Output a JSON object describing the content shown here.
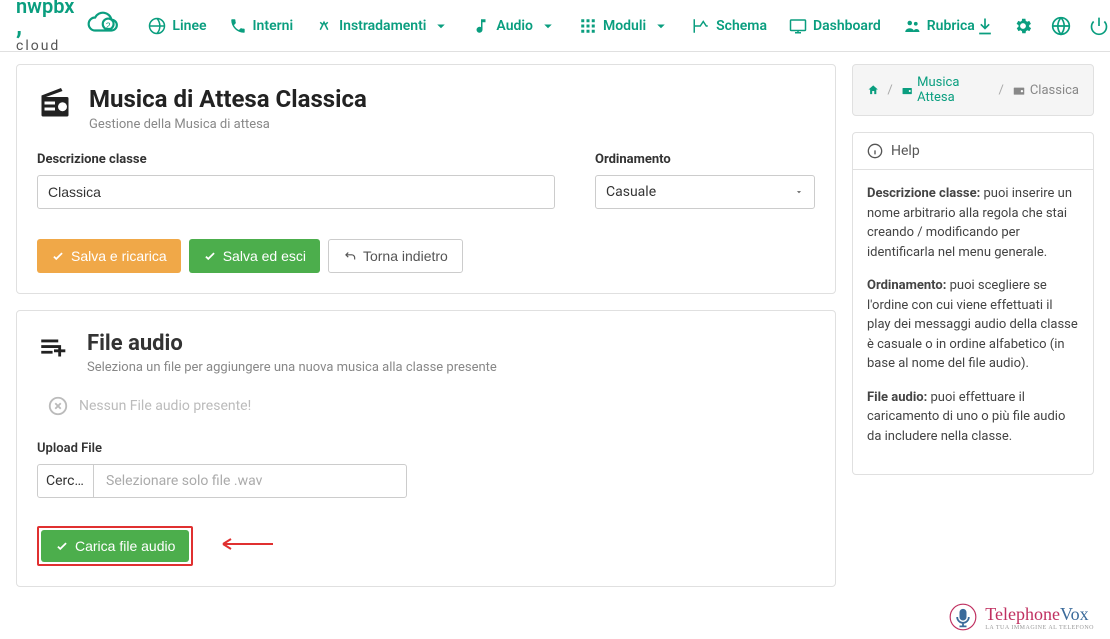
{
  "nav": {
    "items": [
      "Linee",
      "Interni",
      "Instradamenti",
      "Audio",
      "Moduli",
      "Schema",
      "Dashboard",
      "Rubrica"
    ]
  },
  "breadcrumb": {
    "mid": "Musica Attesa",
    "end": "Classica"
  },
  "page": {
    "title": "Musica di Attesa Classica",
    "subtitle": "Gestione della Musica di attesa"
  },
  "form": {
    "desc_label": "Descrizione classe",
    "desc_value": "Classica",
    "ord_label": "Ordinamento",
    "ord_value": "Casuale",
    "btn_save_reload": "Salva e ricarica",
    "btn_save_exit": "Salva ed esci",
    "btn_back": "Torna indietro"
  },
  "files": {
    "title": "File audio",
    "subtitle": "Seleziona un file per aggiungere una nuova musica alla classe presente",
    "empty": "Nessun File audio presente!",
    "upload_label": "Upload File",
    "browse": "Cerca…",
    "placeholder": "Selezionare solo file .wav",
    "submit": "Carica file audio"
  },
  "help": {
    "title": "Help",
    "p1b": "Descrizione classe:",
    "p1": " puoi inserire un nome arbitrario alla regola che stai creando / modificando per identificarla nel menu generale.",
    "p2b": "Ordinamento:",
    "p2": " puoi scegliere se l'ordine con cui viene effettuati il play dei messaggi audio della classe è casuale o in ordine alfabetico (in base al nome del file audio).",
    "p3b": "File audio:",
    "p3": " puoi effettuare il caricamento di uno o più file audio da includere nella classe."
  },
  "brand": {
    "name": "TelephoneVox",
    "tag": "LA TUA IMMAGINE AL TELEFONO"
  }
}
